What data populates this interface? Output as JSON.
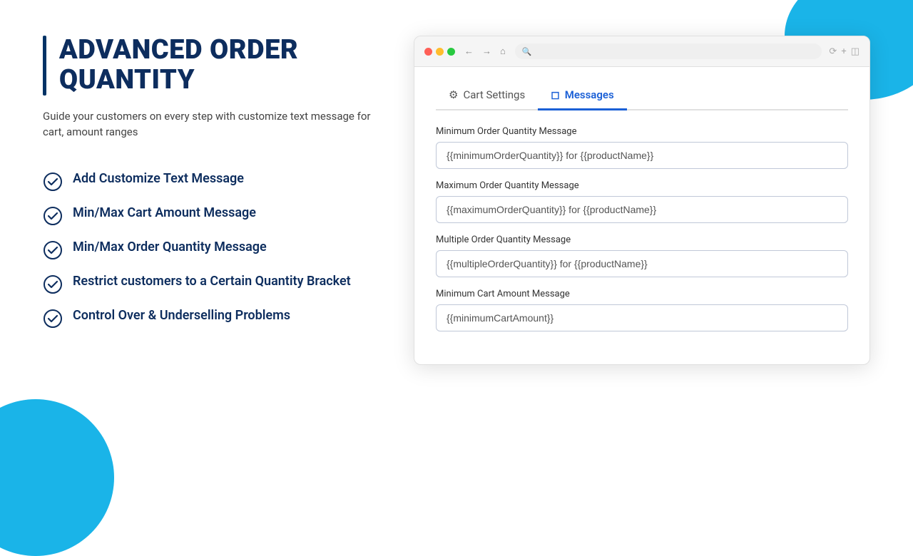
{
  "deco": {
    "top_right_color": "#1ab4e8",
    "bottom_left_color": "#1ab4e8"
  },
  "header": {
    "title": "ADVANCED ORDER QUANTITY",
    "subtitle": "Guide your customers on every step with customize text message for cart, amount ranges"
  },
  "features": [
    {
      "id": "feature-1",
      "label": "Add Customize Text Message"
    },
    {
      "id": "feature-2",
      "label": "Min/Max Cart Amount Message"
    },
    {
      "id": "feature-3",
      "label": "Min/Max Order Quantity Message"
    },
    {
      "id": "feature-4",
      "label": "Restrict customers to a Certain Quantity Bracket"
    },
    {
      "id": "feature-5",
      "label": "Control  Over & Underselling Problems"
    }
  ],
  "browser": {
    "tabs": [
      {
        "id": "cart-settings",
        "label": "Cart Settings",
        "icon": "⚙",
        "active": false
      },
      {
        "id": "messages",
        "label": "Messages",
        "icon": "☐",
        "active": true
      }
    ],
    "fields": [
      {
        "id": "min-order-qty",
        "label": "Minimum Order Quantity Message",
        "value": "{{minimumOrderQuantity}} for {{productName}}"
      },
      {
        "id": "max-order-qty",
        "label": "Maximum Order Quantity Message",
        "value": "{{maximumOrderQuantity}} for {{productName}}"
      },
      {
        "id": "multiple-order-qty",
        "label": "Multiple Order Quantity Message",
        "value": "{{multipleOrderQuantity}} for {{productName}}"
      },
      {
        "id": "min-cart-amount",
        "label": "Minimum Cart Amount Message",
        "value": "{{minimumCartAmount}}"
      }
    ]
  }
}
